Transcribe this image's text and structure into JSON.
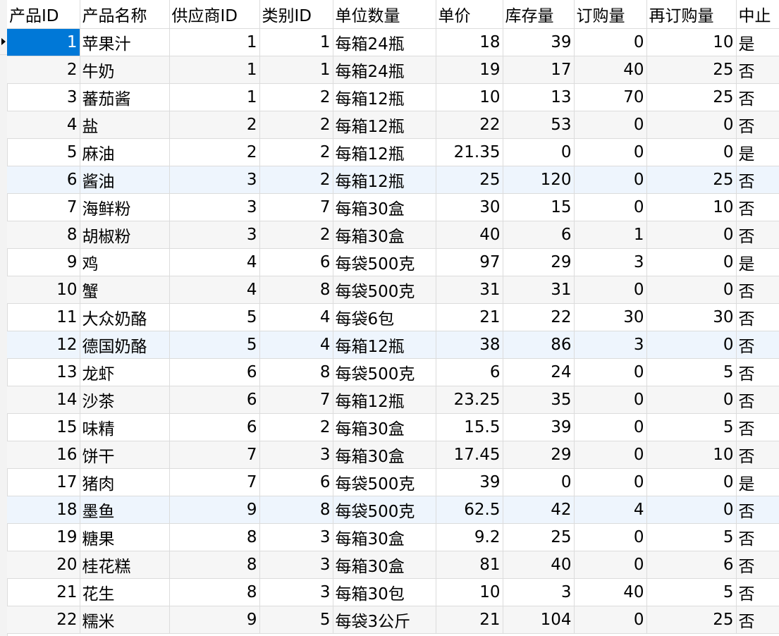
{
  "columns": [
    "产品ID",
    "产品名称",
    "供应商ID",
    "类别ID",
    "单位数量",
    "单价",
    "库存量",
    "订购量",
    "再订购量",
    "中止"
  ],
  "rows": [
    [
      "1",
      "苹果汁",
      "1",
      "1",
      "每箱24瓶",
      "18",
      "39",
      "0",
      "10",
      "是"
    ],
    [
      "2",
      "牛奶",
      "1",
      "1",
      "每箱24瓶",
      "19",
      "17",
      "40",
      "25",
      "否"
    ],
    [
      "3",
      "蕃茄酱",
      "1",
      "2",
      "每箱12瓶",
      "10",
      "13",
      "70",
      "25",
      "否"
    ],
    [
      "4",
      "盐",
      "2",
      "2",
      "每箱12瓶",
      "22",
      "53",
      "0",
      "0",
      "否"
    ],
    [
      "5",
      "麻油",
      "2",
      "2",
      "每箱12瓶",
      "21.35",
      "0",
      "0",
      "0",
      "是"
    ],
    [
      "6",
      "酱油",
      "3",
      "2",
      "每箱12瓶",
      "25",
      "120",
      "0",
      "25",
      "否"
    ],
    [
      "7",
      "海鲜粉",
      "3",
      "7",
      "每箱30盒",
      "30",
      "15",
      "0",
      "10",
      "否"
    ],
    [
      "8",
      "胡椒粉",
      "3",
      "2",
      "每箱30盒",
      "40",
      "6",
      "1",
      "0",
      "否"
    ],
    [
      "9",
      "鸡",
      "4",
      "6",
      "每袋500克",
      "97",
      "29",
      "3",
      "0",
      "是"
    ],
    [
      "10",
      "蟹",
      "4",
      "8",
      "每袋500克",
      "31",
      "31",
      "0",
      "0",
      "否"
    ],
    [
      "11",
      "大众奶酪",
      "5",
      "4",
      "每袋6包",
      "21",
      "22",
      "30",
      "30",
      "否"
    ],
    [
      "12",
      "德国奶酪",
      "5",
      "4",
      "每箱12瓶",
      "38",
      "86",
      "3",
      "0",
      "否"
    ],
    [
      "13",
      "龙虾",
      "6",
      "8",
      "每袋500克",
      "6",
      "24",
      "0",
      "5",
      "否"
    ],
    [
      "14",
      "沙茶",
      "6",
      "7",
      "每箱12瓶",
      "23.25",
      "35",
      "0",
      "0",
      "否"
    ],
    [
      "15",
      "味精",
      "6",
      "2",
      "每箱30盒",
      "15.5",
      "39",
      "0",
      "5",
      "否"
    ],
    [
      "16",
      "饼干",
      "7",
      "3",
      "每箱30盒",
      "17.45",
      "29",
      "0",
      "10",
      "否"
    ],
    [
      "17",
      "猪肉",
      "7",
      "6",
      "每袋500克",
      "39",
      "0",
      "0",
      "0",
      "是"
    ],
    [
      "18",
      "墨鱼",
      "9",
      "8",
      "每袋500克",
      "62.5",
      "42",
      "4",
      "0",
      "否"
    ],
    [
      "19",
      "糖果",
      "8",
      "3",
      "每箱30盒",
      "9.2",
      "25",
      "0",
      "5",
      "否"
    ],
    [
      "20",
      "桂花糕",
      "8",
      "3",
      "每箱30盒",
      "81",
      "40",
      "0",
      "6",
      "否"
    ],
    [
      "21",
      "花生",
      "8",
      "3",
      "每箱30包",
      "10",
      "3",
      "40",
      "5",
      "否"
    ],
    [
      "22",
      "糯米",
      "9",
      "5",
      "每袋3公斤",
      "21",
      "104",
      "0",
      "25",
      "否"
    ]
  ],
  "selected_cell": {
    "row": 0,
    "col": 0
  },
  "highlighted_rows": [
    5,
    11,
    17
  ],
  "colors": {
    "selection": "#0078d7",
    "alt_row": "#f6f6f6",
    "hover_row": "#eef5fd",
    "grid_line": "#dcdcdc"
  },
  "icons": {
    "current_row": "triangle-right-icon"
  }
}
